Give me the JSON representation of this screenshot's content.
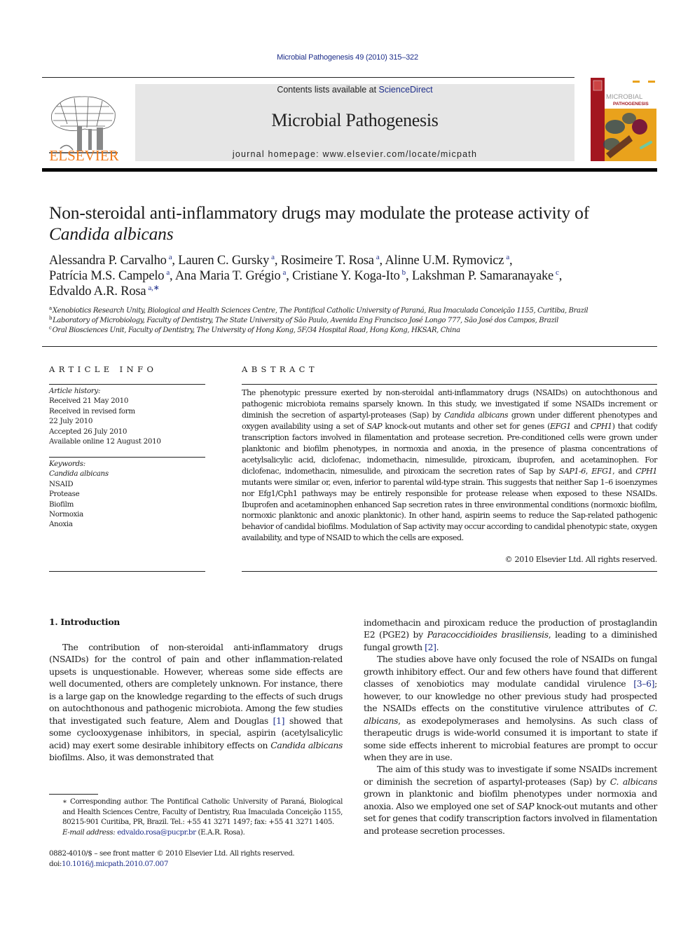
{
  "header": {
    "citation": "Microbial Pathogenesis 49 (2010) 315–322",
    "contents_prefix": "Contents lists available at ",
    "contents_link": "ScienceDirect",
    "journal_name": "Microbial Pathogenesis",
    "homepage": "journal homepage: www.elsevier.com/locate/micpath",
    "publisher_logo_text": "ELSEVIER",
    "cover": {
      "title_line1": "MICROBIAL",
      "title_line2": "PATHOGENESIS",
      "colors": {
        "spine": "#a3161f",
        "background": "#e9a21c",
        "cells": "#2a4a62"
      }
    },
    "colors": {
      "link": "#1f2f8a",
      "publisher": "#f07a1a",
      "banner": "#e6e6e6"
    }
  },
  "article": {
    "title_main": "Non-steroidal anti-inflammatory drugs may modulate the protease activity of",
    "title_species": "Candida albicans",
    "authors": [
      {
        "name": "Alessandra P. Carvalho",
        "aff": "a",
        "sep": ", "
      },
      {
        "name": "Lauren C. Gursky",
        "aff": "a",
        "sep": ", "
      },
      {
        "name": "Rosimeire T. Rosa",
        "aff": "a",
        "sep": ", "
      },
      {
        "name": "Alinne U.M. Rymovicz",
        "aff": "a",
        "sep": ","
      },
      {
        "name": "Patrícia M.S. Campelo",
        "aff": "a",
        "sep": ", "
      },
      {
        "name": "Ana Maria T. Grégio",
        "aff": "a",
        "sep": ", "
      },
      {
        "name": "Cristiane Y. Koga-Ito",
        "aff": "b",
        "sep": ", "
      },
      {
        "name": "Lakshman P. Samaranayake",
        "aff": "c",
        "sep": ","
      },
      {
        "name": "Edvaldo A.R. Rosa",
        "aff": "a,∗",
        "sep": ""
      }
    ],
    "affiliations": [
      {
        "key": "a",
        "text": "Xenobiotics Research Unity, Biological and Health Sciences Centre, The Pontifical Catholic University of Paraná, Rua Imaculada Conceição 1155, Curitiba, Brazil"
      },
      {
        "key": "b",
        "text": "Laboratory of Microbiology, Faculty of Dentistry, The State University of São Paulo, Avenida Eng Francisco José Longo 777, São José dos Campos, Brazil"
      },
      {
        "key": "c",
        "text": "Oral Biosciences Unit, Faculty of Dentistry, The University of Hong Kong, 5F/34 Hospital Road, Hong Kong, HKSAR, China"
      }
    ]
  },
  "article_info": {
    "heading": "ARTICLE INFO",
    "history_label": "Article history:",
    "history": [
      "Received 21 May 2010",
      "Received in revised form",
      "22 July 2010",
      "Accepted 26 July 2010",
      "Available online 12 August 2010"
    ],
    "keywords_label": "Keywords:",
    "keywords": [
      "Candida albicans",
      "NSAID",
      "Protease",
      "Biofilm",
      "Normoxia",
      "Anoxia"
    ]
  },
  "abstract": {
    "heading": "ABSTRACT",
    "segments": [
      {
        "t": "The phenotypic pressure exerted by non-steroidal anti-inflammatory drugs (NSAIDs) on autochthonous and pathogenic microbiota remains sparsely known. In this study, we investigated if some NSAIDs increment or diminish the secretion of aspartyl-proteases (Sap) by "
      },
      {
        "t": "Candida albicans",
        "i": true
      },
      {
        "t": " grown under different phenotypes and oxygen availability using a set of "
      },
      {
        "t": "SAP",
        "i": true
      },
      {
        "t": " knock-out mutants and other set for genes ("
      },
      {
        "t": "EFG1",
        "i": true
      },
      {
        "t": " and "
      },
      {
        "t": "CPH1",
        "i": true
      },
      {
        "t": ") that codify transcription factors involved in filamentation and protease secretion. Pre-conditioned cells were grown under planktonic and biofilm phenotypes, in normoxia and anoxia, in the presence of plasma concentrations of acetylsalicylic acid, diclofenac, indomethacin, nimesulide, piroxicam, ibuprofen, and acetaminophen. For diclofenac, indomethacin, nimesulide, and piroxicam the secretion rates of Sap by "
      },
      {
        "t": "SAP1-6",
        "i": true
      },
      {
        "t": ", "
      },
      {
        "t": "EFG1",
        "i": true
      },
      {
        "t": ", and "
      },
      {
        "t": "CPH1",
        "i": true
      },
      {
        "t": " mutants were similar or, even, inferior to parental wild-type strain. This suggests that neither Sap 1–6 isoenzymes nor Efg1/Cph1 pathways may be entirely responsible for protease release when exposed to these NSAIDs. Ibuprofen and acetaminophen enhanced Sap secretion rates in three environmental conditions (normoxic biofilm, normoxic planktonic and anoxic planktonic). In other hand, aspirin seems to reduce the Sap-related pathogenic behavior of candidal biofilms. Modulation of Sap activity may occur according to candidal phenotypic state, oxygen availability, and type of NSAID to which the cells are exposed."
      }
    ],
    "copyright": "© 2010 Elsevier Ltd. All rights reserved."
  },
  "introduction": {
    "heading": "1.  Introduction",
    "left_paragraphs": [
      [
        {
          "t": "The contribution of non-steroidal anti-inflammatory drugs (NSAIDs) for the control of pain and other inflammation-related upsets is unquestionable. However, whereas some side effects are well documented, others are completely unknown. For instance, there is a large gap on the knowledge regarding to the effects of such drugs on autochthonous and pathogenic microbiota. Among the few studies that investigated such feature, Alem and Douglas "
        },
        {
          "t": "[1]",
          "link": true
        },
        {
          "t": " showed that some cyclooxygenase inhibitors, in special, aspirin (acetylsalicylic acid) may exert some desirable inhibitory effects on "
        },
        {
          "t": "Candida albicans",
          "i": true
        },
        {
          "t": " biofilms. Also, it was demonstrated that"
        }
      ]
    ],
    "right_paragraphs": [
      [
        {
          "t": "indomethacin and piroxicam reduce the production of prostaglandin E2 (PGE2) by "
        },
        {
          "t": "Paracoccidioides brasiliensis",
          "i": true
        },
        {
          "t": ", leading to a diminished fungal growth "
        },
        {
          "t": "[2]",
          "link": true
        },
        {
          "t": "."
        }
      ],
      [
        {
          "t": "The studies above have only focused the role of NSAIDs on fungal growth inhibitory effect. Our and few others have found that different classes of xenobiotics may modulate candidal virulence "
        },
        {
          "t": "[3–6]",
          "link": true
        },
        {
          "t": "; however, to our knowledge no other previous study had prospected the NSAIDs effects on the constitutive virulence attributes of "
        },
        {
          "t": "C. albicans",
          "i": true
        },
        {
          "t": ", as exodepolymerases and hemolysins. As such class of therapeutic drugs is wide-world consumed it is important to state if some side effects inherent to microbial features are prompt to occur when they are in use."
        }
      ],
      [
        {
          "t": "The aim of this study was to investigate if some NSAIDs increment or diminish the secretion of aspartyl-proteases (Sap) by "
        },
        {
          "t": "C. albicans",
          "i": true
        },
        {
          "t": " grown in planktonic and biofilm phenotypes under normoxia and anoxia. Also we employed one set of "
        },
        {
          "t": "SAP",
          "i": true
        },
        {
          "t": " knock-out mutants and other set for genes that codify transcription factors involved in filamentation and protease secretion processes."
        }
      ]
    ]
  },
  "footnotes": {
    "corresponding": "∗ Corresponding author. The Pontifical Catholic University of Paraná, Biological and Health Sciences Centre, Faculty of Dentistry, Rua Imaculada Conceição 1155, 80215-901 Curitiba, PR, Brazil. Tel.: +55 41 3271 1497; fax: +55 41 3271 1405.",
    "email_label": "E-mail address: ",
    "email": "edvaldo.rosa@pucpr.br",
    "email_suffix": " (E.A.R. Rosa).",
    "front_matter": "0882-4010/$ – see front matter © 2010 Elsevier Ltd. All rights reserved.",
    "doi_label": "doi:",
    "doi": "10.1016/j.micpath.2010.07.007"
  }
}
